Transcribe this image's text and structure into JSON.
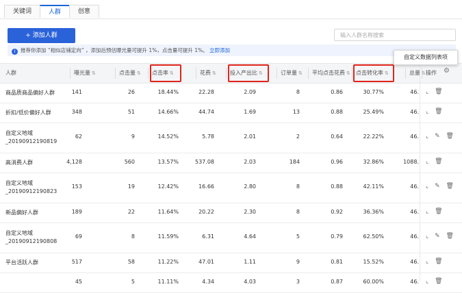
{
  "tabs": [
    {
      "label": "关键词",
      "active": false
    },
    {
      "label": "人群",
      "active": true
    },
    {
      "label": "创意",
      "active": false
    }
  ],
  "add_button": "+ 添加人群",
  "search_placeholder": "输入人群名称搜索",
  "tip": {
    "text": "推荐你添加 “相似店铺定向” ，添加后预估曝光量可提升 1%，点击量可提升 1%。",
    "link": "立即添加"
  },
  "popup_label": "自定义数据列表项",
  "columns": [
    "人群",
    "曝光量",
    "点击量",
    "点击率",
    "花费",
    "投入产出比",
    "订单量",
    "平均点击花费",
    "点击转化率",
    "总量",
    "操作"
  ],
  "highlighted_columns": [
    "点击率",
    "投入产出比",
    "点击转化率"
  ],
  "rows": [
    {
      "name": "商品质商品偏好人群",
      "exposure": "141",
      "clicks": "26",
      "ctr": "18.44%",
      "cost": "22.28",
      "roi": "2.09",
      "orders": "8",
      "cpc": "0.86",
      "cvr": "30.77%",
      "total": "46.",
      "ops": "⌞ 🗑"
    },
    {
      "name": "折扣/低价偏好人群",
      "exposure": "348",
      "clicks": "51",
      "ctr": "14.66%",
      "cost": "44.74",
      "roi": "1.69",
      "orders": "13",
      "cpc": "0.88",
      "cvr": "25.49%",
      "total": "46.",
      "ops": "⌞ 🗑"
    },
    {
      "name": "自定义地域 _20190912190819",
      "exposure": "62",
      "clicks": "9",
      "ctr": "14.52%",
      "cost": "5.78",
      "roi": "2.01",
      "orders": "2",
      "cpc": "0.64",
      "cvr": "22.22%",
      "total": "46.",
      "ops": "⌞ ✎ 🗑"
    },
    {
      "name": "高消费人群",
      "exposure": "4,128",
      "clicks": "560",
      "ctr": "13.57%",
      "cost": "537.08",
      "roi": "2.03",
      "orders": "184",
      "cpc": "0.96",
      "cvr": "32.86%",
      "total": "1088.",
      "ops": "⌞ 🗑"
    },
    {
      "name": "自定义地域 _20190912190823",
      "exposure": "153",
      "clicks": "19",
      "ctr": "12.42%",
      "cost": "16.66",
      "roi": "2.80",
      "orders": "8",
      "cpc": "0.88",
      "cvr": "42.11%",
      "total": "46.",
      "ops": "⌞ ✎ 🗑"
    },
    {
      "name": "新品偏好人群",
      "exposure": "189",
      "clicks": "22",
      "ctr": "11.64%",
      "cost": "20.22",
      "roi": "2.30",
      "orders": "8",
      "cpc": "0.92",
      "cvr": "36.36%",
      "total": "46.",
      "ops": "⌞ 🗑"
    },
    {
      "name": "自定义地域 _20190912190808",
      "exposure": "69",
      "clicks": "8",
      "ctr": "11.59%",
      "cost": "6.31",
      "roi": "4.64",
      "orders": "5",
      "cpc": "0.79",
      "cvr": "62.50%",
      "total": "46.",
      "ops": "⌞ ✎ 🗑"
    },
    {
      "name": "平台活跃人群",
      "exposure": "517",
      "clicks": "58",
      "ctr": "11.22%",
      "cost": "47.01",
      "roi": "1.11",
      "orders": "9",
      "cpc": "0.81",
      "cvr": "15.52%",
      "total": "46.",
      "ops": "⌞ 🗑"
    },
    {
      "name": "",
      "exposure": "45",
      "clicks": "5",
      "ctr": "11.11%",
      "cost": "4.34",
      "roi": "4.03",
      "orders": "3",
      "cpc": "0.87",
      "cvr": "60.00%",
      "total": "46.",
      "ops": "⌞ 🗑"
    }
  ]
}
